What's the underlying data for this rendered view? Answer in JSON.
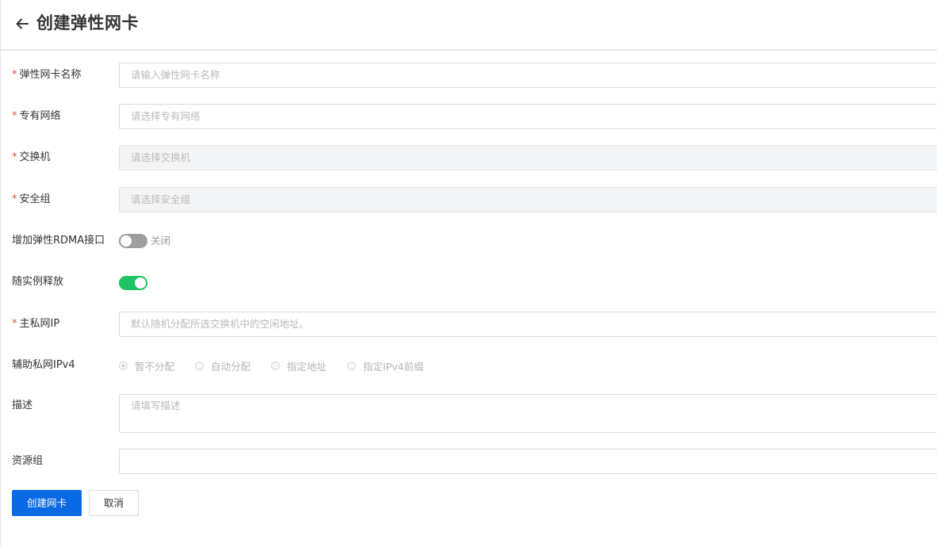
{
  "header": {
    "title": "创建弹性网卡",
    "back_icon": "arrow-left-icon"
  },
  "form": {
    "eni_name": {
      "label": "弹性网卡名称",
      "required": "*",
      "placeholder": "请输入弹性网卡名称"
    },
    "vpc": {
      "label": "专有网络",
      "required": "*",
      "placeholder": "请选择专有网络"
    },
    "vswitch": {
      "label": "交换机",
      "required": "*",
      "placeholder": "请选择交换机"
    },
    "security_group": {
      "label": "安全组",
      "required": "*",
      "placeholder": "请选择安全组"
    },
    "rdma": {
      "label": "增加弹性RDMA接口",
      "state_text": "关闭",
      "enabled": false
    },
    "release_with_instance": {
      "label": "随实例释放",
      "enabled": true
    },
    "primary_ip": {
      "label": "主私网IP",
      "required": "*",
      "placeholder": "默认随机分配所选交换机中的空闲地址。"
    },
    "secondary_ipv4": {
      "label": "辅助私网IPv4",
      "options": [
        "暂不分配",
        "自动分配",
        "指定地址",
        "指定IPv4前缀"
      ],
      "selected": "暂不分配"
    },
    "description": {
      "label": "描述",
      "placeholder": "请填写描述"
    },
    "resource_group": {
      "label": "资源组",
      "value": ""
    }
  },
  "actions": {
    "submit_label": "创建网卡",
    "cancel_label": "取消"
  },
  "colors": {
    "primary": "#0a6ae6",
    "toggle_on": "#1ec463",
    "toggle_off": "#9e9e9e",
    "required": "#e84a3a"
  }
}
